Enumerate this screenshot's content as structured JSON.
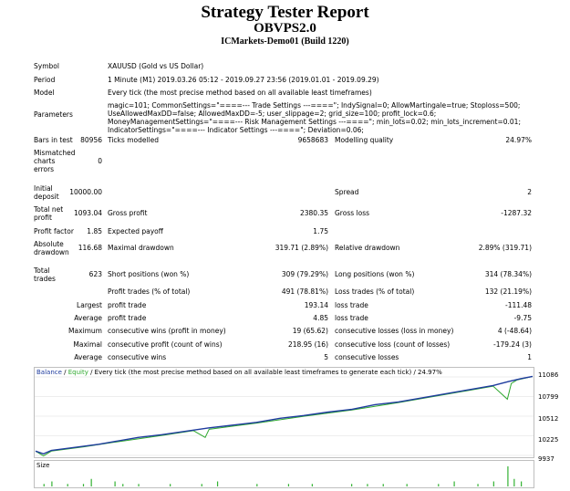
{
  "header": {
    "title": "Strategy Tester Report",
    "subtitle": "OBVPS2.0",
    "build": "ICMarkets-Demo01 (Build 1220)"
  },
  "info": {
    "symbol_label": "Symbol",
    "symbol_value": "XAUUSD (Gold vs US Dollar)",
    "period_label": "Period",
    "period_value": "1 Minute (M1) 2019.03.26 05:12 - 2019.09.27 23:56 (2019.01.01 - 2019.09.29)",
    "model_label": "Model",
    "model_value": "Every tick (the most precise method based on all available least timeframes)",
    "params_label": "Parameters",
    "params_value": "magic=101; CommonSettings=\"====--- Trade Settings ---====\"; IndySignal=0; AllowMartingale=true; Stoploss=500; UseAllowedMaxDD=false; AllowedMaxDD=-5; user_slippage=2; grid_size=100; profit_lock=0.6; MoneyManagementSettings=\"====--- Risk Management Settings ---====\"; min_lots=0.02; min_lots_increment=0.01; IndicatorSettings=\"====--- Indicator Settings ---====\"; Deviation=0.06;"
  },
  "stats": {
    "bars_label": "Bars in test",
    "bars_value": "80956",
    "ticks_label": "Ticks modelled",
    "ticks_value": "9658683",
    "quality_label": "Modelling quality",
    "quality_value": "24.97%",
    "mismatch_label": "Mismatched charts errors",
    "mismatch_value": "0",
    "deposit_label": "Initial deposit",
    "deposit_value": "10000.00",
    "spread_label": "Spread",
    "spread_value": "2",
    "netprofit_label": "Total net profit",
    "netprofit_value": "1093.04",
    "grossprofit_label": "Gross profit",
    "grossprofit_value": "2380.35",
    "grossloss_label": "Gross loss",
    "grossloss_value": "-1287.32",
    "pf_label": "Profit factor",
    "pf_value": "1.85",
    "payoff_label": "Expected payoff",
    "payoff_value": "1.75",
    "absdd_label": "Absolute drawdown",
    "absdd_value": "116.68",
    "maxdd_label": "Maximal drawdown",
    "maxdd_value": "319.71 (2.89%)",
    "reldd_label": "Relative drawdown",
    "reldd_value": "2.89% (319.71)",
    "trades_label": "Total trades",
    "trades_value": "623",
    "short_label": "Short positions (won %)",
    "short_value": "309 (79.29%)",
    "long_label": "Long positions (won %)",
    "long_value": "314 (78.34%)",
    "pt_label": "Profit trades (% of total)",
    "pt_value": "491 (78.81%)",
    "lt_label": "Loss trades (% of total)",
    "lt_value": "132 (21.19%)",
    "largest_label": "Largest",
    "largest_pt_label": "profit trade",
    "largest_pt_value": "193.14",
    "largest_lt_label": "loss trade",
    "largest_lt_value": "-111.48",
    "average_label": "Average",
    "average_pt_label": "profit trade",
    "average_pt_value": "4.85",
    "average_lt_label": "loss trade",
    "average_lt_value": "-9.75",
    "maximum_label": "Maximum",
    "max_cw_label": "consecutive wins (profit in money)",
    "max_cw_value": "19 (65.62)",
    "max_cl_label": "consecutive losses (loss in money)",
    "max_cl_value": "4 (-48.64)",
    "maximal_label": "Maximal",
    "maximal_cp_label": "consecutive profit (count of wins)",
    "maximal_cp_value": "218.95 (16)",
    "maximal_cl_label": "consecutive loss (count of losses)",
    "maximal_cl_value": "-179.24 (3)",
    "average2_label": "Average",
    "avg_cw_label": "consecutive wins",
    "avg_cw_value": "5",
    "avg_cl_label": "consecutive losses",
    "avg_cl_value": "1"
  },
  "chart_legend": {
    "balance": "Balance",
    "sep1": " / ",
    "equity": "Equity",
    "desc": " / Every tick (the most precise method based on all available least timeframes to generate each tick) / 24.97%"
  },
  "size_label": "Size",
  "colors": {
    "balance": "#1f3c9e",
    "equity": "#2ea82e",
    "size": "#33b233"
  },
  "chart_data": {
    "type": "line",
    "title": "",
    "xlabel": "",
    "ylabel": "",
    "yticks": [
      11086,
      10799,
      10512,
      10225,
      9937
    ],
    "ylim": [
      9937,
      11086
    ],
    "xlim": [
      0,
      630
    ],
    "series": [
      {
        "name": "Balance",
        "x": [
          0,
          10,
          20,
          40,
          60,
          80,
          100,
          130,
          160,
          190,
          220,
          250,
          280,
          310,
          340,
          370,
          400,
          430,
          460,
          490,
          520,
          550,
          580,
          600,
          615,
          630
        ],
        "values": [
          10000,
          9960,
          10010,
          10040,
          10070,
          10100,
          10140,
          10200,
          10240,
          10290,
          10340,
          10380,
          10420,
          10480,
          10520,
          10570,
          10610,
          10680,
          10720,
          10780,
          10840,
          10900,
          10960,
          11020,
          11060,
          11093
        ]
      },
      {
        "name": "Equity",
        "x": [
          0,
          10,
          20,
          60,
          100,
          160,
          200,
          215,
          220,
          280,
          340,
          400,
          460,
          520,
          580,
          598,
          603,
          610,
          630
        ],
        "values": [
          10000,
          9930,
          10000,
          10060,
          10130,
          10230,
          10300,
          10200,
          10320,
          10410,
          10510,
          10600,
          10710,
          10830,
          10950,
          10760,
          10990,
          11040,
          11093
        ]
      }
    ],
    "size_x": [
      10,
      20,
      40,
      60,
      70,
      100,
      110,
      130,
      170,
      210,
      230,
      280,
      320,
      350,
      400,
      420,
      440,
      470,
      510,
      530,
      560,
      580,
      598,
      606,
      615
    ],
    "size_values": [
      1,
      2,
      1,
      1,
      3,
      2,
      1,
      1,
      1,
      1,
      2,
      1,
      1,
      1,
      1,
      1,
      1,
      1,
      1,
      2,
      1,
      2,
      8,
      3,
      2
    ],
    "xticks": [
      "0",
      "30",
      "70",
      "100",
      "137",
      "162",
      "190",
      "215",
      "241",
      "270",
      "298",
      "324",
      "354",
      "384",
      "417",
      "441",
      "468",
      "496",
      "524",
      "550",
      "579",
      "602",
      "624"
    ]
  }
}
